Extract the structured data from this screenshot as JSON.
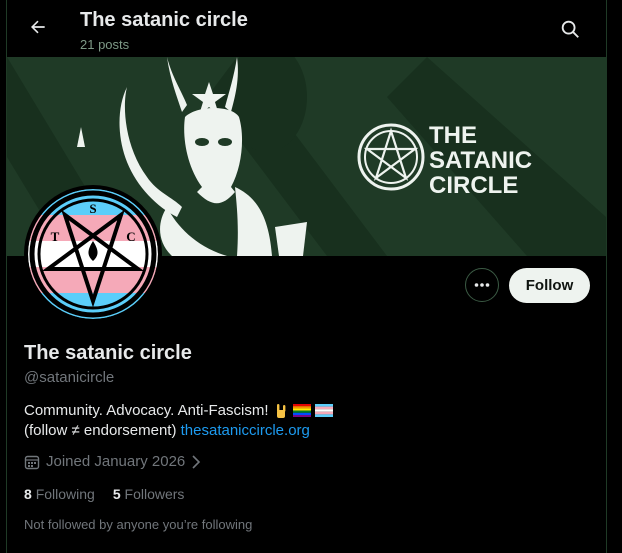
{
  "header": {
    "title": "The satanic circle",
    "posts": "21 posts"
  },
  "banner": {
    "logo_line1": "THE",
    "logo_line2": "SATANIC",
    "logo_line3": "CIRCLE"
  },
  "avatar": {
    "letters": [
      "T",
      "S",
      "C"
    ]
  },
  "actions": {
    "follow_label": "Follow"
  },
  "profile": {
    "name": "The satanic circle",
    "handle": "@satanicircle",
    "bio_line1": "Community. Advocacy. Anti-Fascism!",
    "bio_line2_text": "(follow ≠ endorsement)",
    "bio_link": "thesataniccircle.org",
    "joined": "Joined January 2026",
    "following_count": "8",
    "following_label": "Following",
    "followers_count": "5",
    "followers_label": "Followers",
    "not_followed": "Not followed by anyone you’re following"
  },
  "colors": {
    "banner_bg": "#1f3a26",
    "link": "#1d9bf0",
    "muted": "#71767b"
  }
}
